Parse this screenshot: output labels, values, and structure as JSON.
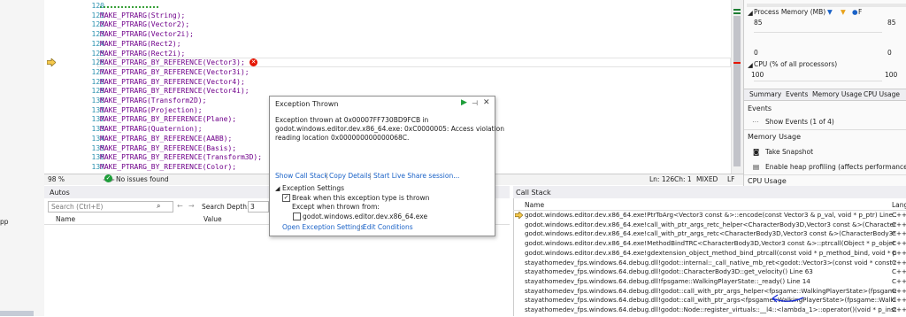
{
  "editor": {
    "lines": [
      {
        "num": "120",
        "code": ""
      },
      {
        "num": "121",
        "code": "MAKE_PTRARG(String);"
      },
      {
        "num": "122",
        "code": "MAKE_PTRARG(Vector2);"
      },
      {
        "num": "123",
        "code": "MAKE_PTRARG(Vector2i);"
      },
      {
        "num": "124",
        "code": "MAKE_PTRARG(Rect2);"
      },
      {
        "num": "125",
        "code": "MAKE_PTRARG(Rect2i);"
      },
      {
        "num": "126",
        "code": "MAKE_PTRARG_BY_REFERENCE(Vector3);"
      },
      {
        "num": "127",
        "code": "MAKE_PTRARG_BY_REFERENCE(Vector3i);"
      },
      {
        "num": "128",
        "code": "MAKE_PTRARG_BY_REFERENCE(Vector4);"
      },
      {
        "num": "129",
        "code": "MAKE_PTRARG_BY_REFERENCE(Vector4i);"
      },
      {
        "num": "130",
        "code": "MAKE_PTRARG(Transform2D);"
      },
      {
        "num": "131",
        "code": "MAKE_PTRARG(Projection);"
      },
      {
        "num": "132",
        "code": "MAKE_PTRARG_BY_REFERENCE(Plane);"
      },
      {
        "num": "133",
        "code": "MAKE_PTRARG(Quaternion);"
      },
      {
        "num": "134",
        "code": "MAKE_PTRARG_BY_REFERENCE(AABB);"
      },
      {
        "num": "135",
        "code": "MAKE_PTRARG_BY_REFERENCE(Basis);"
      },
      {
        "num": "136",
        "code": "MAKE_PTRARG_BY_REFERENCE(Transform3D);"
      },
      {
        "num": "137",
        "code": "MAKE_PTRARG_BY_REFERENCE(Color);"
      }
    ],
    "status": {
      "zoom": "98 %",
      "issues": "No issues found",
      "ln": "Ln: 126",
      "ch": "Ch: 1",
      "mode": "MIXED",
      "eol": "LF"
    }
  },
  "exception": {
    "title": "Exception Thrown",
    "message_line1": "Exception thrown at 0x00007FF730BD9FCB in",
    "message_line2": "godot.windows.editor.dev.x86_64.exe: 0xC0000005: Access violation",
    "message_line3": "reading location 0x000000000000068C.",
    "link_callstack": "Show Call Stack",
    "link_copy": "Copy Details",
    "link_liveshare": "Start Live Share session...",
    "settings_header": "Exception Settings",
    "break_label": "Break when this exception type is thrown",
    "except_label": "Except when thrown from:",
    "except_item": "godot.windows.editor.dev.x86_64.exe",
    "link_open_settings": "Open Exception Settings",
    "link_edit_conditions": "Edit Conditions"
  },
  "diagnostics": {
    "process_memory_label": "Process Memory (MB)",
    "legend_f": "F",
    "mem_max_left": "85",
    "mem_min_left": "0",
    "mem_max_right": "85",
    "mem_min_right": "0",
    "cpu_label": "CPU (% of all processors)",
    "cpu_left": "100",
    "cpu_right": "100",
    "tabs": [
      "Summary",
      "Events",
      "Memory Usage",
      "CPU Usage"
    ],
    "events_header": "Events",
    "show_events": "Show Events (1 of 4)",
    "memory_header": "Memory Usage",
    "take_snapshot": "Take Snapshot",
    "heap_profiling": "Enable heap profiling (affects performance)",
    "cpu_usage_header": "CPU Usage"
  },
  "autos": {
    "title": "Autos",
    "search_placeholder": "Search (Ctrl+E)",
    "search_depth_label": "Search Depth:",
    "search_depth_value": "3",
    "col_name": "Name",
    "col_value": "Value"
  },
  "callstack": {
    "title": "Call Stack",
    "col_name": "Name",
    "col_lang": "Lang",
    "rows": [
      {
        "name": "godot.windows.editor.dev.x86_64.exe!PtrToArg<Vector3 const &>::encode(const Vector3 & p_val, void * p_ptr) Line 126",
        "lang": "C++"
      },
      {
        "name": "godot.windows.editor.dev.x86_64.exe!call_with_ptr_args_retc_helper<CharacterBody3D,Vector3 const &>(CharacterBody3...",
        "lang": "C++"
      },
      {
        "name": "godot.windows.editor.dev.x86_64.exe!call_with_ptr_args_retc<CharacterBody3D,Vector3 const &>(CharacterBody3* p_i...",
        "lang": "C++"
      },
      {
        "name": "godot.windows.editor.dev.x86_64.exe!MethodBindTRC<CharacterBody3D,Vector3 const &>::ptrcall(Object * p_object, co...",
        "lang": "C++"
      },
      {
        "name": "godot.windows.editor.dev.x86_64.exe!gdextension_object_method_bind_ptrcall(const void * p_method_bind, void * p_ins...",
        "lang": "C++"
      },
      {
        "name": "stayathomedev_fps.windows.64.debug.dll!godot::internal::_call_native_mb_ret<godot::Vector3>(const void * const mb, v...",
        "lang": "C++"
      },
      {
        "name": "stayathomedev_fps.windows.64.debug.dll!godot::CharacterBody3D::get_velocity() Line 63",
        "lang": "C++"
      },
      {
        "name": "stayathomedev_fps.windows.64.debug.dll!fpsgame::WalkingPlayerState::_ready() Line 14",
        "lang": "C++"
      },
      {
        "name": "stayathomedev_fps.windows.64.debug.dll!godot::call_with_ptr_args_helper<fpsgame::WalkingPlayerState>(fpsgame::Wal...",
        "lang": "C++"
      },
      {
        "name": "stayathomedev_fps.windows.64.debug.dll!godot::call_with_ptr_args<fpsgame::WalkingPlayerState>(fpsgame::WalkingPla...",
        "lang": "C++"
      },
      {
        "name": "stayathomedev_fps.windows.64.debug.dll!godot::Node::register_virtuals::__l4::<lambda_1>::operator()(void * p_instance, ...",
        "lang": "C++"
      }
    ]
  },
  "left_panel": {
    "label": "pp"
  },
  "colors": {
    "accent": "#007acc",
    "link": "#1a62c7",
    "error": "#e51400",
    "annotation": "#1b2fd8"
  }
}
